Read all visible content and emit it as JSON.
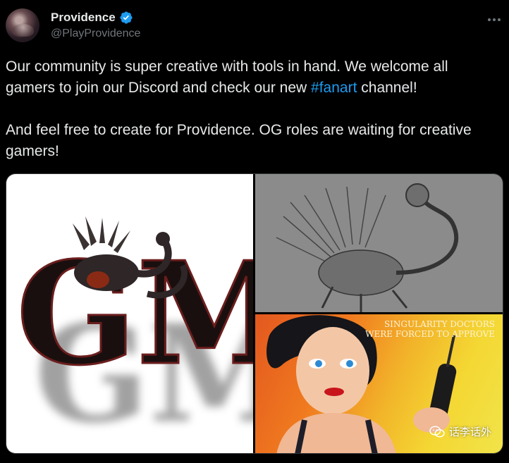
{
  "author": {
    "display_name": "Providence",
    "handle": "@PlayProvidence",
    "verified": true
  },
  "tweet": {
    "line1_before": "Our community is super creative with tools in hand. We welcome all gamers to join our Discord and check our new ",
    "hashtag": "#fanart",
    "line1_after": " channel!",
    "paragraph2": "And feel free to create for Providence. OG roles are waiting for creative gamers!"
  },
  "media": {
    "image_right_bottom_caption": "SINGULARITY DOCTORS WERE FORCED TO APPROVE",
    "logo_text": "GM",
    "watermark": "话李话外"
  },
  "colors": {
    "background": "#000000",
    "text": "#e7e9ea",
    "muted": "#71767b",
    "link": "#1d9bf0",
    "verified": "#1d9bf0"
  },
  "icons": [
    "verified-badge-icon",
    "more-options-icon",
    "wechat-watermark-icon"
  ]
}
